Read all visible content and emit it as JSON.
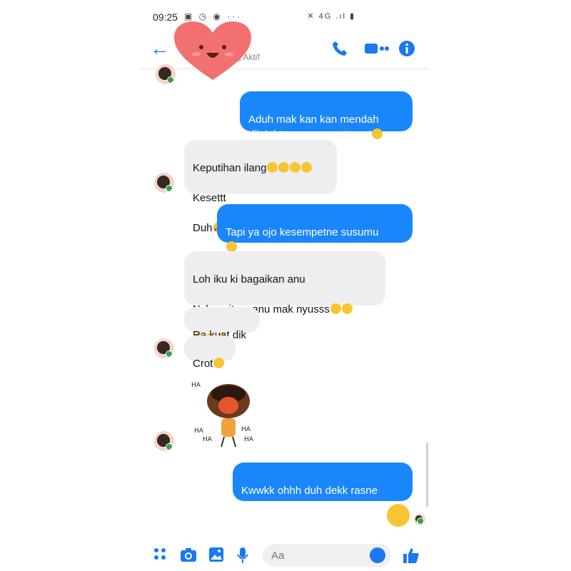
{
  "status_bar": {
    "time": "09:25",
    "left_icons": "▣ ◷ ◉  ···",
    "right_icons": "✕ 4G .ıl ▮"
  },
  "header": {
    "subtitle": "g Aktif",
    "back_icon": "arrow-left-icon",
    "call_icon": "phone-icon",
    "video_icon": "video-camera-icon",
    "info_icon": "info-icon"
  },
  "messages": [
    {
      "dir": "out",
      "text": "Aduh mak kan kan mendah\ndijajal tenan mampet gegt",
      "emoji": 1
    },
    {
      "dir": "in",
      "lines": [
        "Keputihan ilang",
        "Kesettt",
        "Duh"
      ],
      "emoji_line1": 4,
      "emoji_line3": 3
    },
    {
      "dir": "out",
      "text": "Tapi ya ojo kesempetne susumu",
      "emoji": 1
    },
    {
      "dir": "in",
      "lines": [
        "Loh iku ki bagaikan anu",
        "Nylempit ng anu mak nyusss"
      ],
      "emoji_line2": 2,
      "emoji_line3": 3
    },
    {
      "dir": "in",
      "text": "Ra kuat dik"
    },
    {
      "dir": "in",
      "text": "Crot",
      "emoji": 1
    },
    {
      "dir": "out",
      "text": "Kwwkk ohhh duh dekk rasne\nlinu"
    }
  ],
  "sticker_text": [
    "HA",
    "HA",
    "HA",
    "HA",
    "HA"
  ],
  "composer": {
    "placeholder": "Aa"
  },
  "colors": {
    "accent": "#1a78f2",
    "outgoing_bubble": "#1a86fb",
    "incoming_bubble": "#eeeef0"
  }
}
